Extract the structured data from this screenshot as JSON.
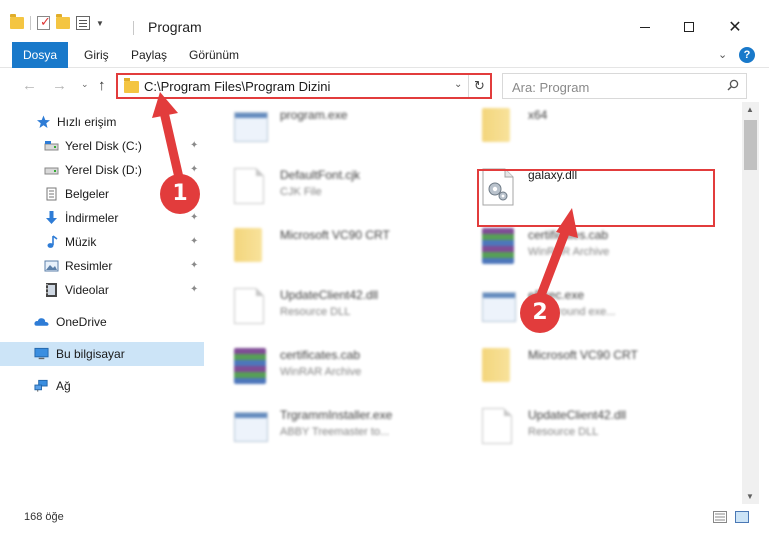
{
  "window": {
    "title": "Program",
    "minimize_glyph": "",
    "maximize_glyph": "",
    "close_glyph": "✕"
  },
  "ribbon": {
    "tabs": [
      "Dosya",
      "Giriş",
      "Paylaş",
      "Görünüm"
    ],
    "chevron": "⌄",
    "help": "?"
  },
  "address_bar": {
    "path": "C:\\Program Files\\Program Dizini",
    "dropdown_glyph": "⌄",
    "refresh_glyph": "↻"
  },
  "search": {
    "placeholder": "Ara: Program"
  },
  "nav": {
    "back": "←",
    "forward": "→",
    "recent": "⌄",
    "up": "↑"
  },
  "sidebar": {
    "items": [
      {
        "label": "Hızlı erişim",
        "icon": "star-icon",
        "pinned": false
      },
      {
        "label": "Yerel Disk (C:)",
        "icon": "drive-icon",
        "pinned": true
      },
      {
        "label": "Yerel Disk (D:)",
        "icon": "drive-icon",
        "pinned": true
      },
      {
        "label": "Belgeler",
        "icon": "documents-icon",
        "pinned": true
      },
      {
        "label": "İndirmeler",
        "icon": "download-icon",
        "pinned": true
      },
      {
        "label": "Müzik",
        "icon": "music-icon",
        "pinned": true
      },
      {
        "label": "Resimler",
        "icon": "pictures-icon",
        "pinned": true
      },
      {
        "label": "Videolar",
        "icon": "video-icon",
        "pinned": true
      },
      {
        "label": "OneDrive",
        "icon": "cloud-icon",
        "pinned": false
      },
      {
        "label": "Bu bilgisayar",
        "icon": "computer-icon",
        "pinned": false,
        "selected": true
      },
      {
        "label": "Ağ",
        "icon": "network-icon",
        "pinned": false
      }
    ],
    "pin_glyph": "📌"
  },
  "files": [
    {
      "name": "program.exe",
      "type": "",
      "icon": "exe-icon",
      "column": 0,
      "row": 0
    },
    {
      "name": "x64",
      "type": "",
      "icon": "folder-icon",
      "column": 1,
      "row": 0
    },
    {
      "name": "DefaultFont.cjk",
      "type": "CJK File",
      "icon": "doc-icon",
      "column": 0,
      "row": 1
    },
    {
      "name": "galaxy.dll",
      "type": "",
      "icon": "dll-icon",
      "column": 1,
      "row": 1,
      "highlighted": true
    },
    {
      "name": "Microsoft VC90 CRT",
      "type": "",
      "icon": "folder-icon",
      "column": 0,
      "row": 2
    },
    {
      "name": "certificates.cab",
      "type": "WinRAR Archive",
      "icon": "rar-icon",
      "column": 1,
      "row": 2
    },
    {
      "name": "UpdateClient42.dll",
      "type": "Resource DLL",
      "icon": "dll-icon",
      "column": 0,
      "row": 3
    },
    {
      "name": "eExec.exe",
      "type": "background exe...",
      "icon": "exe-icon",
      "column": 1,
      "row": 3
    },
    {
      "name": "certificates.cab",
      "type": "WinRAR Archive",
      "icon": "rar-icon",
      "column": 0,
      "row": 4
    },
    {
      "name": "Microsoft VC90 CRT",
      "type": "",
      "icon": "folder-icon",
      "column": 1,
      "row": 4
    },
    {
      "name": "TrgrammInstaller.exe",
      "type": "ABBY Treemaster to...",
      "icon": "exe-icon",
      "column": 0,
      "row": 5
    },
    {
      "name": "UpdateClient42.dll",
      "type": "Resource DLL",
      "icon": "dll-icon",
      "column": 1,
      "row": 5
    }
  ],
  "callouts": [
    "1",
    "2"
  ],
  "scrollbar": {
    "up": "▲",
    "down": "▼"
  },
  "status": {
    "item_count": "168 öğe"
  },
  "colors": {
    "accent": "#1979ca",
    "highlight_red": "#e23c3c",
    "selection": "#cce4f7"
  }
}
